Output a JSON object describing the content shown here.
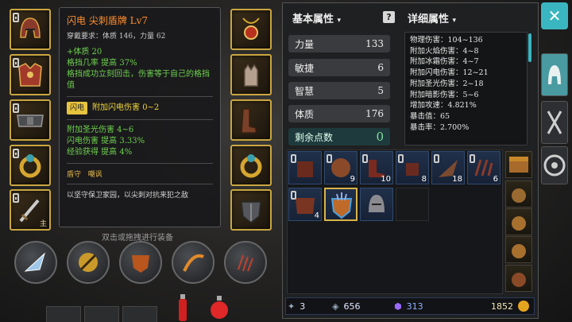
{
  "tooltip": {
    "title": "闪电 尖刺盾牌 Lv7",
    "requirement": "穿戴要求：体质 146，力量 62",
    "bonuses": [
      "+体质 20",
      "格挡几率 提高 37%",
      "格挡成功立刻回击，伤害等于自己的格挡值"
    ],
    "element_badge": "闪电",
    "element_text": "附加闪电伤害 0~2",
    "magic_props": [
      "附加圣光伤害 4~6",
      "闪电伤害 提高 3.33%",
      "经验获得 提高 4%"
    ],
    "skill_label": "盾守",
    "skill_name": "嘲讽",
    "flavor": "以坚守保卫家园，以尖刺对抗来犯之敌"
  },
  "equipment": {
    "hint": "双击或拖拽进行装备",
    "weapon_tag": "主"
  },
  "panel": {
    "basic_header": "基本属性",
    "detail_header": "详细属性",
    "stats": [
      {
        "label": "力量",
        "value": "133"
      },
      {
        "label": "敏捷",
        "value": "6"
      },
      {
        "label": "智慧",
        "value": "5"
      },
      {
        "label": "体质",
        "value": "176"
      }
    ],
    "remaining_label": "剩余点数",
    "remaining_value": "0",
    "details": [
      "物理伤害：104~136",
      "附加火焰伤害：4~8",
      "附加冰霜伤害：4~7",
      "附加闪电伤害：12~21",
      "附加圣光伤害：2~18",
      "附加暗影伤害：5~6",
      "增加攻速：4.821%",
      "暴击值：65",
      "暴击率：2.700%"
    ]
  },
  "inventory": {
    "quantities": [
      "",
      "9",
      "10",
      "8",
      "18",
      "6",
      "4",
      "",
      "",
      ""
    ]
  },
  "resources": {
    "keys": "3",
    "scrolls": "656",
    "gems": "313",
    "gold": "1852"
  },
  "colors": {
    "accent_orange": "#ff8f2e",
    "bonus_green": "#6fd14f",
    "unique_yellow": "#f0d43a",
    "equip_border": "#c9a640",
    "close_button": "#3ab6c0",
    "active_tab": "#4a9aa2"
  }
}
